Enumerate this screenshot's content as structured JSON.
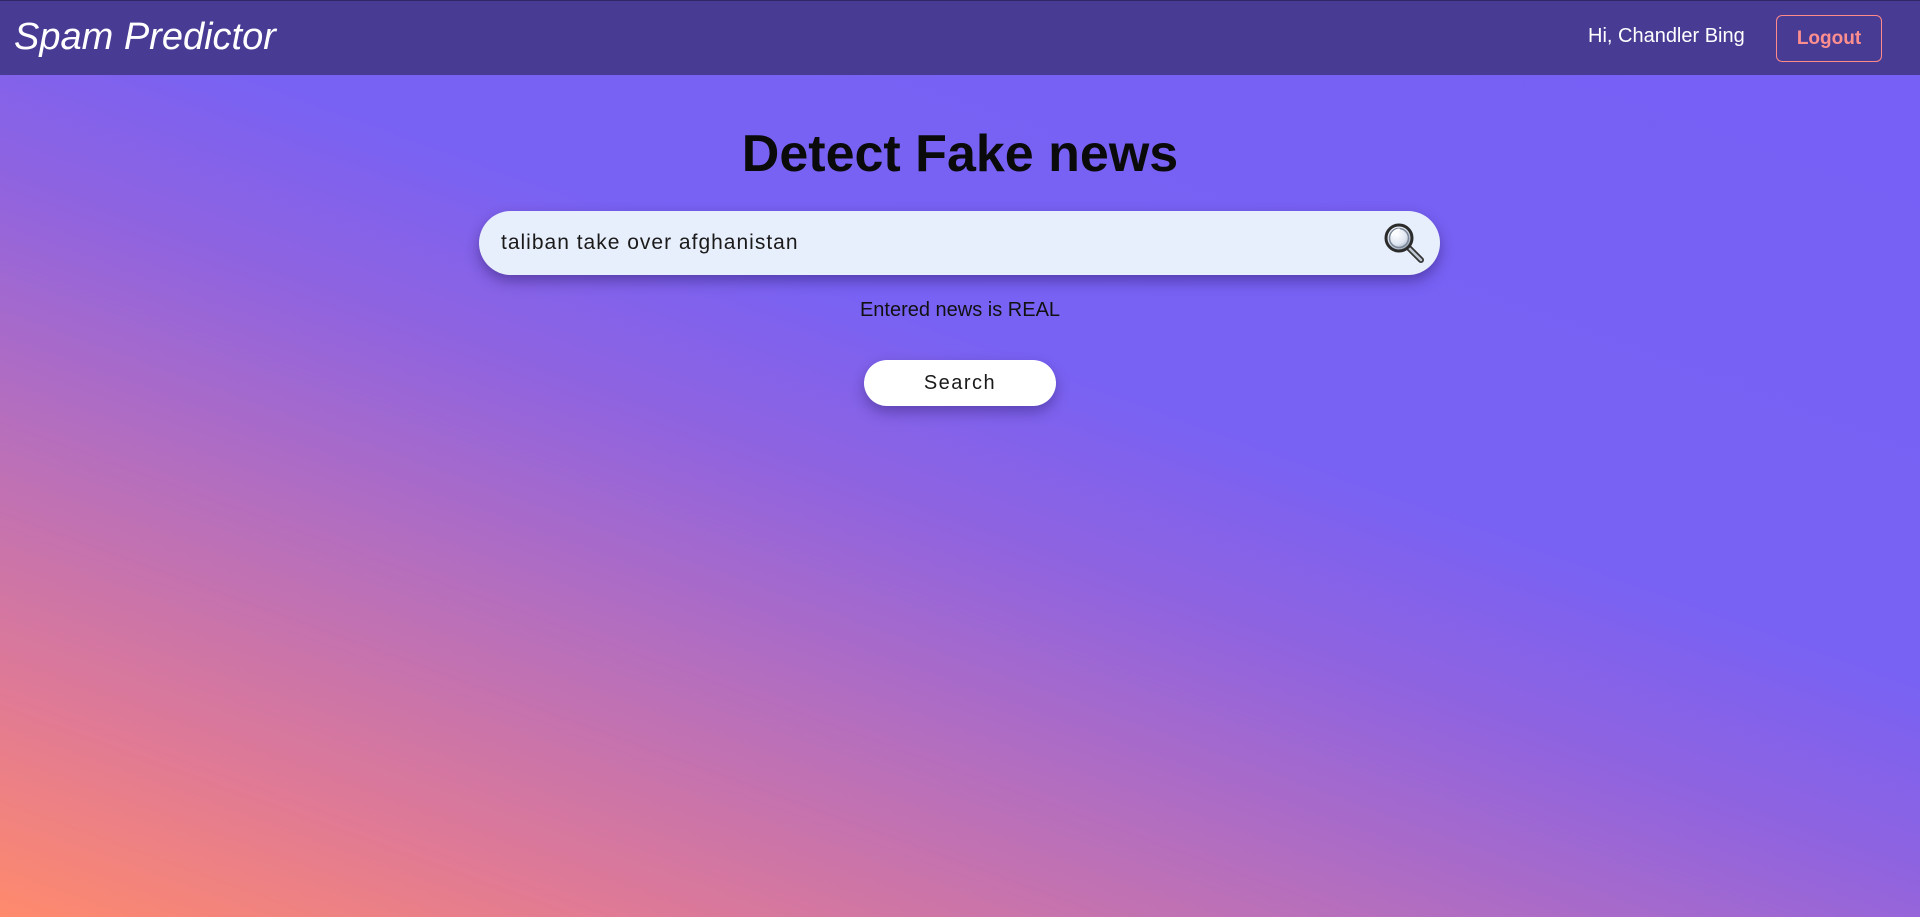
{
  "navbar": {
    "brand": "Spam Predictor",
    "greeting": "Hi, Chandler Bing",
    "logout_label": "Logout"
  },
  "main": {
    "title": "Detect Fake news",
    "search": {
      "value": "taliban take over afghanistan",
      "icon": "magnifier-icon"
    },
    "result_text": "Entered news is REAL",
    "search_button_label": "Search"
  },
  "colors": {
    "navbar": "#483b94",
    "logout_accent": "#ff8f8f",
    "gradient_start": "#ff8a6c",
    "gradient_end": "#7660f5",
    "input_background": "#e8effc"
  }
}
